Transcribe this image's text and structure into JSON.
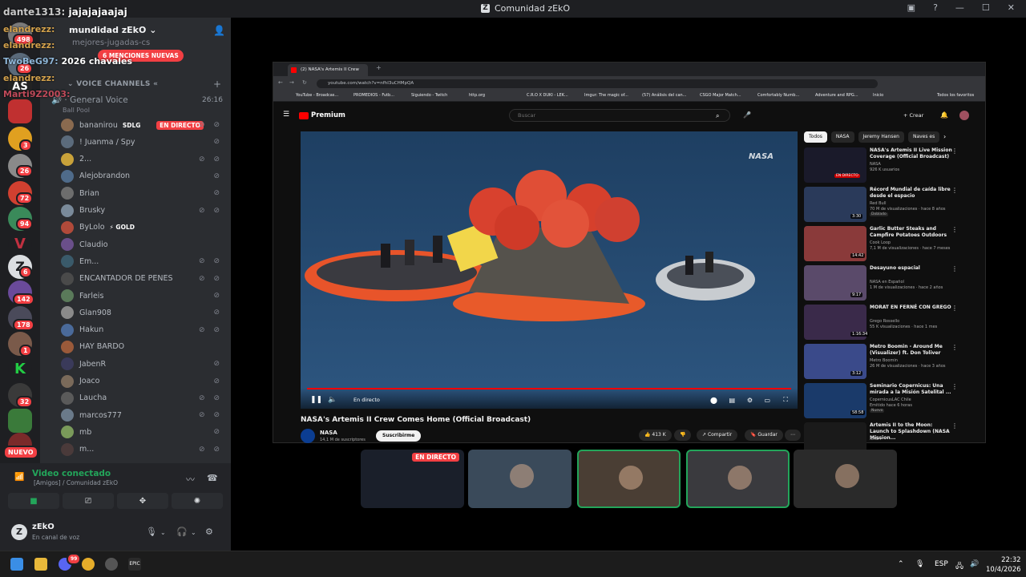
{
  "window": {
    "title": "Comunidad zEkO",
    "controls": [
      "—",
      "☐",
      "✕"
    ]
  },
  "chat_overlay": [
    {
      "user": "dante1313:",
      "msg": "jajajajaajaj"
    },
    {
      "user": "elandrezz:",
      "msg": ""
    },
    {
      "user": "elandrezz:",
      "msg": ""
    },
    {
      "user": "TwoBeG97:",
      "msg": "2026 chavales"
    },
    {
      "user": "elandrezz:",
      "msg": ""
    },
    {
      "user": "Marti9Z2003:",
      "msg": ""
    }
  ],
  "server": {
    "name": "mundidad zEkO",
    "hidden_channel": "mejores-jugadas-cs",
    "mentions": "6 MENCIONES NUEVAS"
  },
  "rail_badges": [
    "498",
    "26",
    "3",
    "26",
    "72",
    "94",
    "6",
    "142",
    "178",
    "1",
    "32"
  ],
  "rail_new": "NUEVO",
  "voice": {
    "category": "VOICE CHANNELS",
    "channel": "General Voice",
    "time": "26:16",
    "pool_label": "Ball Pool",
    "live_label": "EN DIRECTO",
    "members": [
      {
        "name": "bananirou",
        "tag": "SDLG",
        "live": true,
        "status": "⊘ ⊘",
        "color": "#8a6a4f"
      },
      {
        "name": "! Juanma / Spy",
        "status": "⊘",
        "color": "#5b6b7c"
      },
      {
        "name": "2...",
        "status": "⊘ ⊘",
        "color": "#c9a23a"
      },
      {
        "name": "Alejobrandon",
        "status": "⊘",
        "color": "#4f6b8a"
      },
      {
        "name": "Brian",
        "status": "⊘",
        "color": "#6d6d6d"
      },
      {
        "name": "Brusky",
        "status": "⊘ ⊘",
        "color": "#7a8a9a"
      },
      {
        "name": "ByLolo",
        "tag": "⚡ GOLD",
        "status": "",
        "color": "#b04a3a"
      },
      {
        "name": "Claudio",
        "status": "",
        "color": "#6a4f8a"
      },
      {
        "name": "Em...",
        "status": "⊘ ⊘",
        "color": "#3a5a6a"
      },
      {
        "name": "ENCANTADOR DE PENES",
        "status": "⊘ ⊘",
        "color": "#4a4a4a"
      },
      {
        "name": "Farleis",
        "status": "⊘",
        "color": "#5a7a5a"
      },
      {
        "name": "Glan908",
        "status": "⊘",
        "color": "#8a8a8a"
      },
      {
        "name": "Hakun",
        "status": "⊘ ⊘",
        "color": "#4a6a9a"
      },
      {
        "name": "HAY BARDO",
        "status": "",
        "color": "#9a5a3a"
      },
      {
        "name": "JabenR",
        "status": "⊘",
        "color": "#3a3a5a"
      },
      {
        "name": "Joaco",
        "status": "⊘",
        "color": "#7a6a5a"
      },
      {
        "name": "Laucha",
        "status": "⊘ ⊘",
        "color": "#5a5a5a"
      },
      {
        "name": "marcos777",
        "status": "⊘ ⊘",
        "color": "#6a7a8a"
      },
      {
        "name": "mb",
        "status": "⊘",
        "color": "#7a9a5a"
      },
      {
        "name": "m...",
        "status": "⊘ ⊘",
        "color": "#4a3a3a"
      }
    ]
  },
  "voice_panel": {
    "title": "Video conectado",
    "subtitle": "[Amigos] / Comunidad zEkO",
    "user_name": "zEkO",
    "user_status": "En canal de voz"
  },
  "browser": {
    "tab_title": "(2) NASA's Artemis II Crew",
    "url": "youtube.com/watch?v=nfhI3uCHMpQA",
    "bookmarks": [
      "YouTube - Broadcas...",
      "PROMEDIOS - Futb...",
      "Siguiendo - Twitch",
      "http.org",
      "C.R.O X DUKI - LEK...",
      "Imgur: The magic of...",
      "(57) Análisis del can...",
      "CSGO Major Match...",
      "Comfortably Numb...",
      "Adventure and RPG...",
      "Inicio",
      "Todos los favoritos"
    ]
  },
  "youtube": {
    "logo_text": "Premium",
    "search_placeholder": "Buscar",
    "create_label": "+ Crear",
    "player_live_label": "En directo",
    "watermark": "NASA",
    "video_title": "NASA's Artemis II Crew Comes Home (Official Broadcast)",
    "channel_name": "NASA",
    "channel_subs": "14,1 M de suscriptores",
    "subscribe_label": "Suscribirme",
    "likes": "413 K",
    "share_label": "Compartir",
    "save_label": "Guardar",
    "chips": [
      "Todos",
      "NASA",
      "Jeremy Hansen",
      "Naves es"
    ],
    "recommendations": [
      {
        "title": "NASA's Artemis II Live Mission Coverage (Official Broadcast)",
        "channel": "NASA",
        "meta": "926 K usuarios",
        "badge": "EN DIRECTO",
        "duration": "",
        "color": "#1a1a2a"
      },
      {
        "title": "Récord Mundial de caída libre desde el espacio",
        "channel": "Red Bull",
        "meta": "70 M de visualizaciones · hace 8 años",
        "badge": "Doblado",
        "duration": "3:30",
        "color": "#2a3a5a"
      },
      {
        "title": "Garlic Butter Steaks and Campfire Potatoes Outdoors",
        "channel": "Cook Loop",
        "meta": "7,1 M de visualizaciones · hace 7 meses",
        "badge": "",
        "duration": "14:42",
        "color": "#8a3a3a"
      },
      {
        "title": "Desayuno espacial",
        "channel": "NASA en Español",
        "meta": "1 M de visualizaciones · hace 2 años",
        "badge": "",
        "duration": "9:17",
        "color": "#5a4a6a"
      },
      {
        "title": "MORAT EN FERNÉ CON GREGO",
        "channel": "Grego Rossello",
        "meta": "55 K visualizaciones · hace 1 mes",
        "badge": "",
        "duration": "1:16:34",
        "color": "#3a2a4a"
      },
      {
        "title": "Metro Boomin - Around Me (Visualizer) ft. Don Toliver",
        "channel": "Metro Boomin",
        "meta": "26 M de visualizaciones · hace 3 años",
        "badge": "",
        "duration": "3:12",
        "color": "#3a4a8a"
      },
      {
        "title": "Seminario Copernicus: Una mirada a la Misión Satelital ...",
        "channel": "CopernicusLAC Chile",
        "meta": "Emitido hace 6 horas",
        "badge": "Nuevo",
        "duration": "58:58",
        "color": "#1a3a6a"
      },
      {
        "title": "Artemis II to the Moon: Launch to Splashdown (NASA Mission...",
        "channel": "NASA",
        "meta": "",
        "badge": "",
        "duration": "",
        "color": "#1a1a1a"
      }
    ]
  },
  "tiles": [
    {
      "name": "tile-screen",
      "live": "EN DIRECTO",
      "color": "#1a1f2a",
      "speaking": false
    },
    {
      "name": "tile-cam-1",
      "live": "",
      "color": "#3a4a5a",
      "speaking": false
    },
    {
      "name": "tile-cam-2",
      "live": "",
      "color": "#4a3e34",
      "speaking": true
    },
    {
      "name": "tile-cam-3",
      "live": "",
      "color": "#3a3a3e",
      "speaking": true
    },
    {
      "name": "tile-cam-4",
      "live": "",
      "color": "#2a2a2a",
      "speaking": false
    }
  ],
  "taskbar": {
    "lang": "ESP",
    "time": "22:32",
    "date": "10/4/2026",
    "discord_badge": "99"
  }
}
